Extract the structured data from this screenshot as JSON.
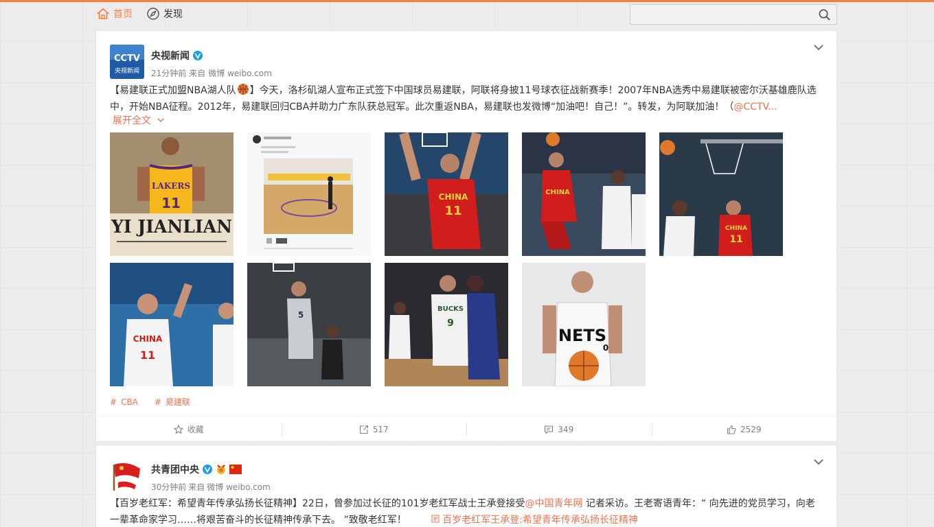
{
  "nav": {
    "home_label": "首页",
    "discover_label": "发现",
    "search_placeholder": ""
  },
  "colors": {
    "accent": "#fa7d3c",
    "link": "#eb7350"
  },
  "post1": {
    "author": "央视新闻",
    "avatar_text": "央视新闻",
    "time": "21分钟前",
    "source_prefix": "来自",
    "source": "微博 weibo.com",
    "text_part1": "【易建联正式加盟NBA湖人队",
    "text_part2": "】今天，洛杉矶湖人宣布正式签下中国球员易建联，阿联将身披11号球衣征战新赛季！2007年NBA选秀中易建联被密尔沃基雄鹿队选中，开始NBA征程。2012年，易建联回归CBA并助力广东队获总冠军。此次重返NBA，易建联也发微博“加油吧！自己！”。转发，为阿联加油！（",
    "mention": "@CCTV...",
    "expand_label": "展开全文",
    "tags": [
      "CBA",
      "易建联"
    ],
    "actions": {
      "favorite": "收藏",
      "repost": "517",
      "comment": "349",
      "like": "2529"
    },
    "images": [
      {
        "name": "lakers-poster",
        "caption": "YI JIANLIAN",
        "jersey": "LAKERS",
        "number": "11"
      },
      {
        "name": "weibo-screenshot"
      },
      {
        "name": "china-dunk-1",
        "team": "CHINA",
        "number": "11"
      },
      {
        "name": "china-layup",
        "team": "CHINA"
      },
      {
        "name": "china-dunk-2",
        "team": "CHINA",
        "number": "11"
      },
      {
        "name": "china-highfive",
        "team": "CHINA",
        "number": "11"
      },
      {
        "name": "mavericks-dunk",
        "number": "5"
      },
      {
        "name": "bucks-game",
        "team": "BUCKS",
        "number": "9"
      },
      {
        "name": "nets-portrait",
        "team": "NETS",
        "number": "0"
      }
    ]
  },
  "post2": {
    "author": "共青团中央",
    "time": "30分钟前",
    "source_prefix": "来自",
    "source": "微博 weibo.com",
    "text_part1": "【百岁老红军：希望青年传承弘扬长征精神】22日，曾参加过长征的101岁老红军战士王承登接受",
    "mention": "@中国青年网",
    "text_part2": " 记者采访。王老寄语青年：“ 向先进的党员学习，向老一辈革命家学习……将艰苦奋斗的长征精神传承下去。 ”致敬老红军！",
    "link_text": "百岁老红军王承登:希望青年传承弘扬长征精神"
  }
}
